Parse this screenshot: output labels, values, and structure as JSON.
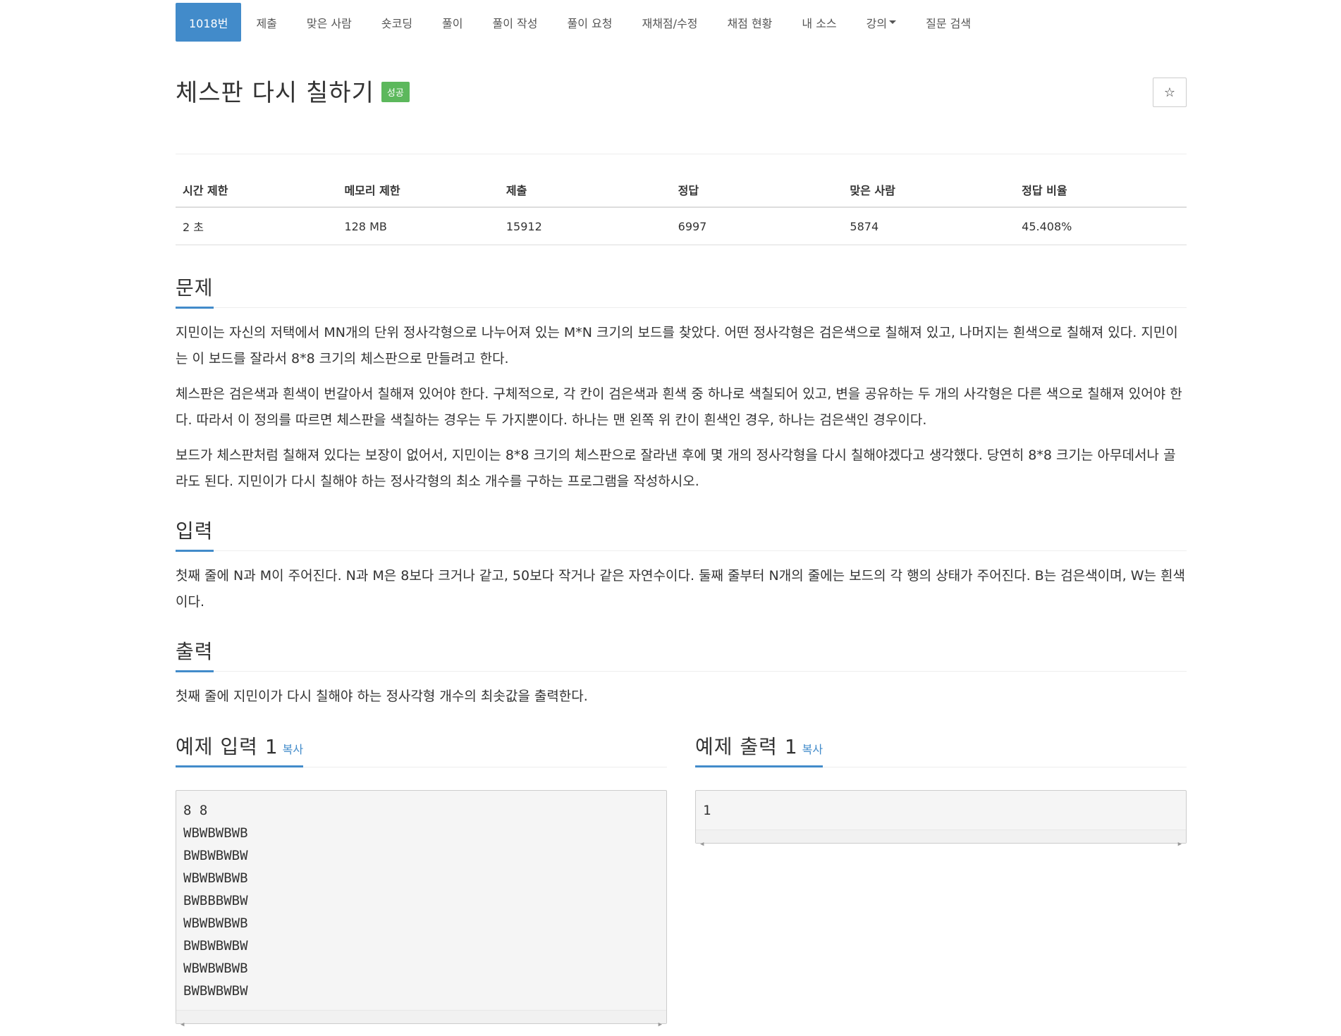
{
  "nav": {
    "tabs": [
      "1018번",
      "제출",
      "맞은 사람",
      "숏코딩",
      "풀이",
      "풀이 작성",
      "풀이 요청",
      "재채점/수정",
      "채점 현황",
      "내 소스",
      "강의",
      "질문 검색"
    ],
    "active_index": 0
  },
  "problem": {
    "title": "체스판 다시 칠하기",
    "badge": "성공",
    "star_icon": "☆"
  },
  "stats": {
    "headers": [
      "시간 제한",
      "메모리 제한",
      "제출",
      "정답",
      "맞은 사람",
      "정답 비율"
    ],
    "values": [
      "2 초",
      "128 MB",
      "15912",
      "6997",
      "5874",
      "45.408%"
    ]
  },
  "sections": {
    "problem": {
      "heading": "문제",
      "paragraphs": [
        "지민이는 자신의 저택에서 MN개의 단위 정사각형으로 나누어져 있는 M*N 크기의 보드를 찾았다. 어떤 정사각형은 검은색으로 칠해져 있고, 나머지는 흰색으로 칠해져 있다. 지민이는 이 보드를 잘라서 8*8 크기의 체스판으로 만들려고 한다.",
        "체스판은 검은색과 흰색이 번갈아서 칠해져 있어야 한다. 구체적으로, 각 칸이 검은색과 흰색 중 하나로 색칠되어 있고, 변을 공유하는 두 개의 사각형은 다른 색으로 칠해져 있어야 한다. 따라서 이 정의를 따르면 체스판을 색칠하는 경우는 두 가지뿐이다. 하나는 맨 왼쪽 위 칸이 흰색인 경우, 하나는 검은색인 경우이다.",
        "보드가 체스판처럼 칠해져 있다는 보장이 없어서, 지민이는 8*8 크기의 체스판으로 잘라낸 후에 몇 개의 정사각형을 다시 칠해야겠다고 생각했다. 당연히 8*8 크기는 아무데서나 골라도 된다. 지민이가 다시 칠해야 하는 정사각형의 최소 개수를 구하는 프로그램을 작성하시오."
      ]
    },
    "input": {
      "heading": "입력",
      "paragraphs": [
        "첫째 줄에 N과 M이 주어진다. N과 M은 8보다 크거나 같고, 50보다 작거나 같은 자연수이다. 둘째 줄부터 N개의 줄에는 보드의 각 행의 상태가 주어진다. B는 검은색이며, W는 흰색이다."
      ]
    },
    "output": {
      "heading": "출력",
      "paragraphs": [
        "첫째 줄에 지민이가 다시 칠해야 하는 정사각형 개수의 최솟값을 출력한다."
      ]
    }
  },
  "samples": {
    "input": {
      "heading": "예제 입력 1",
      "copy_label": "복사",
      "text": "8 8\nWBWBWBWB\nBWBWBWBW\nWBWBWBWB\nBWBBBWBW\nWBWBWBWB\nBWBWBWBW\nWBWBWBWB\nBWBWBWBW"
    },
    "output": {
      "heading": "예제 출력 1",
      "copy_label": "복사",
      "text": "1"
    }
  },
  "colors": {
    "accent": "#428bca",
    "success": "#5cb85c"
  }
}
